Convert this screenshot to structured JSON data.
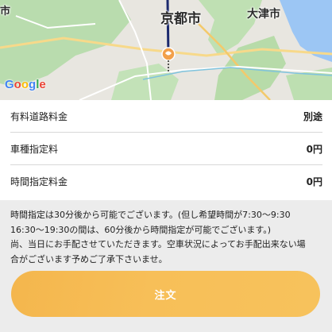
{
  "map": {
    "labels": {
      "kyoto": "京都市",
      "otsu": "大津市",
      "edge": "市"
    },
    "google_logo": [
      {
        "ch": "G",
        "color": "#4285F4"
      },
      {
        "ch": "o",
        "color": "#EA4335"
      },
      {
        "ch": "o",
        "color": "#FBBC05"
      },
      {
        "ch": "g",
        "color": "#4285F4"
      },
      {
        "ch": "l",
        "color": "#34A853"
      },
      {
        "ch": "e",
        "color": "#EA4335"
      }
    ],
    "marker_color": "#f2a04a"
  },
  "fees": [
    {
      "label": "有料道路料金",
      "value": "別途"
    },
    {
      "label": "車種指定料",
      "value": "0円"
    },
    {
      "label": "時間指定料金",
      "value": "0円"
    }
  ],
  "notice": [
    "時間指定は30分後から可能でございます。(但し希望時間が7:30～9:30",
    "16:30～19:30の間は、60分後から時間指定が可能でございます。)",
    "尚、当日にお手配させていただきます。空車状況によってお手配出来ない場",
    "合がございます予めご了承下さいませ。"
  ],
  "order_button": {
    "label": "注文"
  }
}
